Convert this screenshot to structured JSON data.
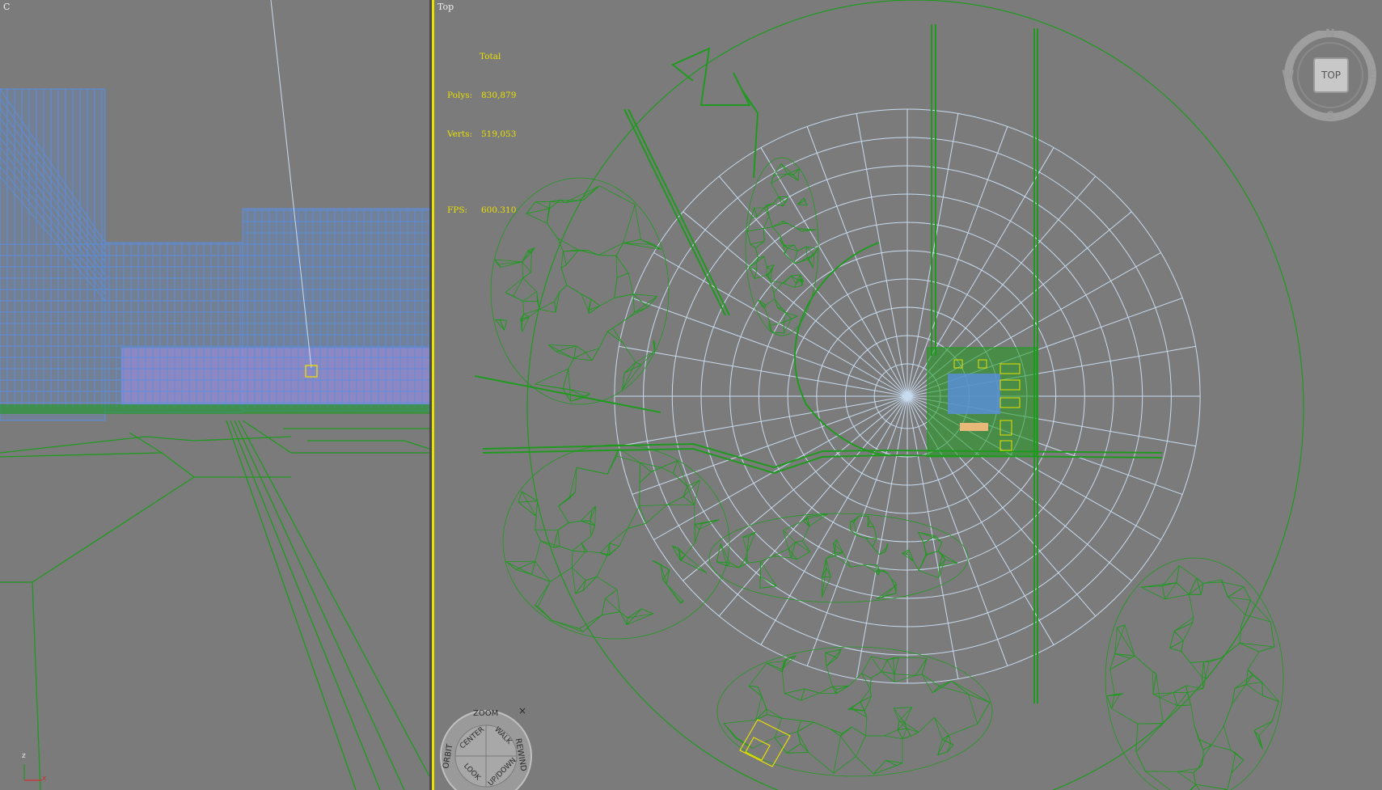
{
  "viewports": {
    "left": {
      "label": "C"
    },
    "right": {
      "label": "Top"
    }
  },
  "stats": {
    "header": "Total",
    "polys_label": "Polys:",
    "polys_value": "830,879",
    "verts_label": "Verts:",
    "verts_value": "519,053",
    "fps_label": "FPS:",
    "fps_value": "600.310"
  },
  "viewcube": {
    "face": "TOP",
    "north": "N",
    "south": "S",
    "east": "E",
    "west": "W"
  },
  "steering_wheel": {
    "zoom": "ZOOM",
    "center": "CENTER",
    "walk": "WALK",
    "orbit": "ORBIT",
    "rewind": "REWIND",
    "look": "LOOK",
    "updown": "UP/DOWN",
    "close": "×"
  },
  "axis_gizmo": {
    "z": "z",
    "x": "x"
  },
  "colors": {
    "wire_green": "#1f9a1f",
    "wire_blue": "#5a8ee0",
    "wire_lightblue": "#c8dcf0",
    "highlight_yellow": "#e8e000",
    "viewport_bg": "#7b7b7b"
  }
}
